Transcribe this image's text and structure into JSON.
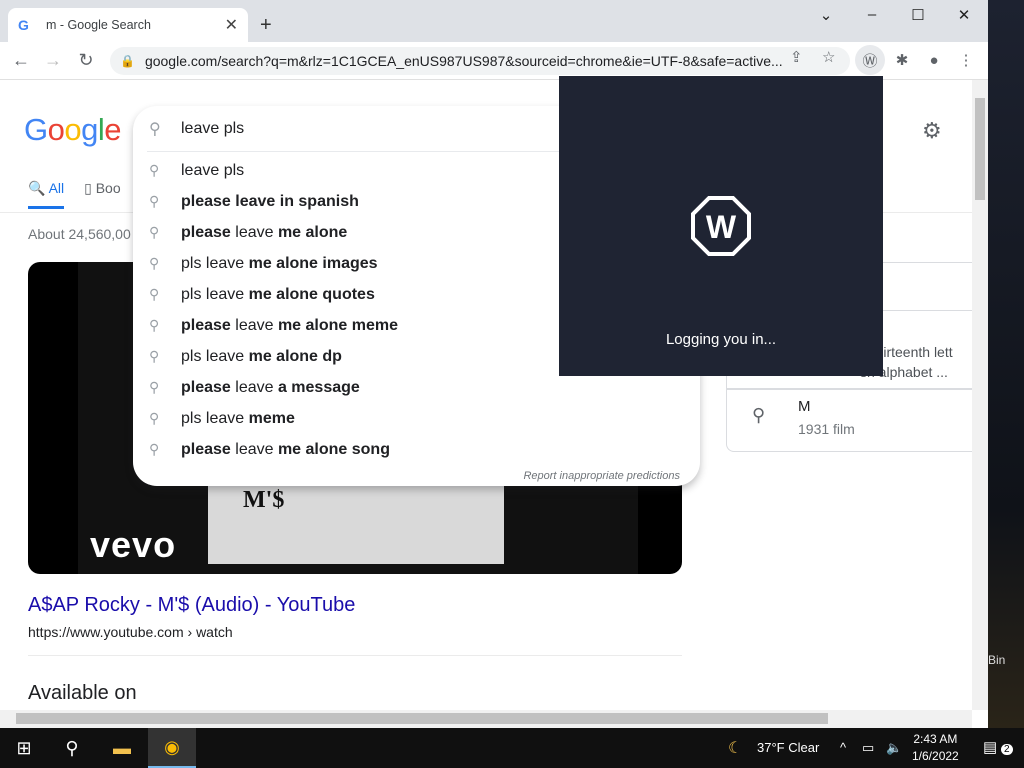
{
  "browser": {
    "tab_title": "m - Google Search",
    "tab_favicon": "G",
    "url": "google.com/search?q=m&rlz=1C1GCEA_enUS987US987&sourceid=chrome&ie=UTF-8&safe=active..."
  },
  "google": {
    "logo_letters": [
      "G",
      "o",
      "o",
      "g",
      "l",
      "e"
    ],
    "logo_colors": [
      "#4285f4",
      "#ea4335",
      "#fbbc05",
      "#4285f4",
      "#34a853",
      "#ea4335"
    ],
    "tabs": {
      "all": "All",
      "books": "Boo"
    },
    "stats": "About 24,560,00"
  },
  "search": {
    "query": "leave pls",
    "suggestions": [
      {
        "pre": "leave pls",
        "bold": ""
      },
      {
        "pre": "",
        "bold": "please leave in spanish"
      },
      {
        "pre": "",
        "bold": "please",
        "mid": " leave ",
        "bold2": "me alone"
      },
      {
        "pre": "pls leave ",
        "bold": "me alone images"
      },
      {
        "pre": "pls leave ",
        "bold": "me alone quotes"
      },
      {
        "pre": "",
        "bold": "please",
        "mid": " leave ",
        "bold2": "me alone meme"
      },
      {
        "pre": "pls leave ",
        "bold": "me alone dp"
      },
      {
        "pre": "",
        "bold": "please",
        "mid": " leave ",
        "bold2": "a message"
      },
      {
        "pre": "pls leave ",
        "bold": "meme"
      },
      {
        "pre": "",
        "bold": "please",
        "mid": " leave ",
        "bold2": "me alone song"
      }
    ],
    "report": "Report inappropriate predictions"
  },
  "result": {
    "brand": "vevo",
    "video_logo": "M'$",
    "title": "A$AP Rocky - M'$ (Audio) - YouTube",
    "url": "https://www.youtube.com › watch",
    "available_on": "Available on"
  },
  "knowledge_panel": {
    "desc_line1": "e thirteenth lett",
    "desc_line2": "sh alphabet ...",
    "item_title": "M",
    "item_sub": "1931 film"
  },
  "extension_popup": {
    "logo_letter": "W",
    "message": "Logging you in..."
  },
  "desktop": {
    "recycle_label": "Bin"
  },
  "taskbar": {
    "weather": "37°F  Clear",
    "time": "2:43 AM",
    "date": "1/6/2022",
    "notification_count": "2"
  }
}
